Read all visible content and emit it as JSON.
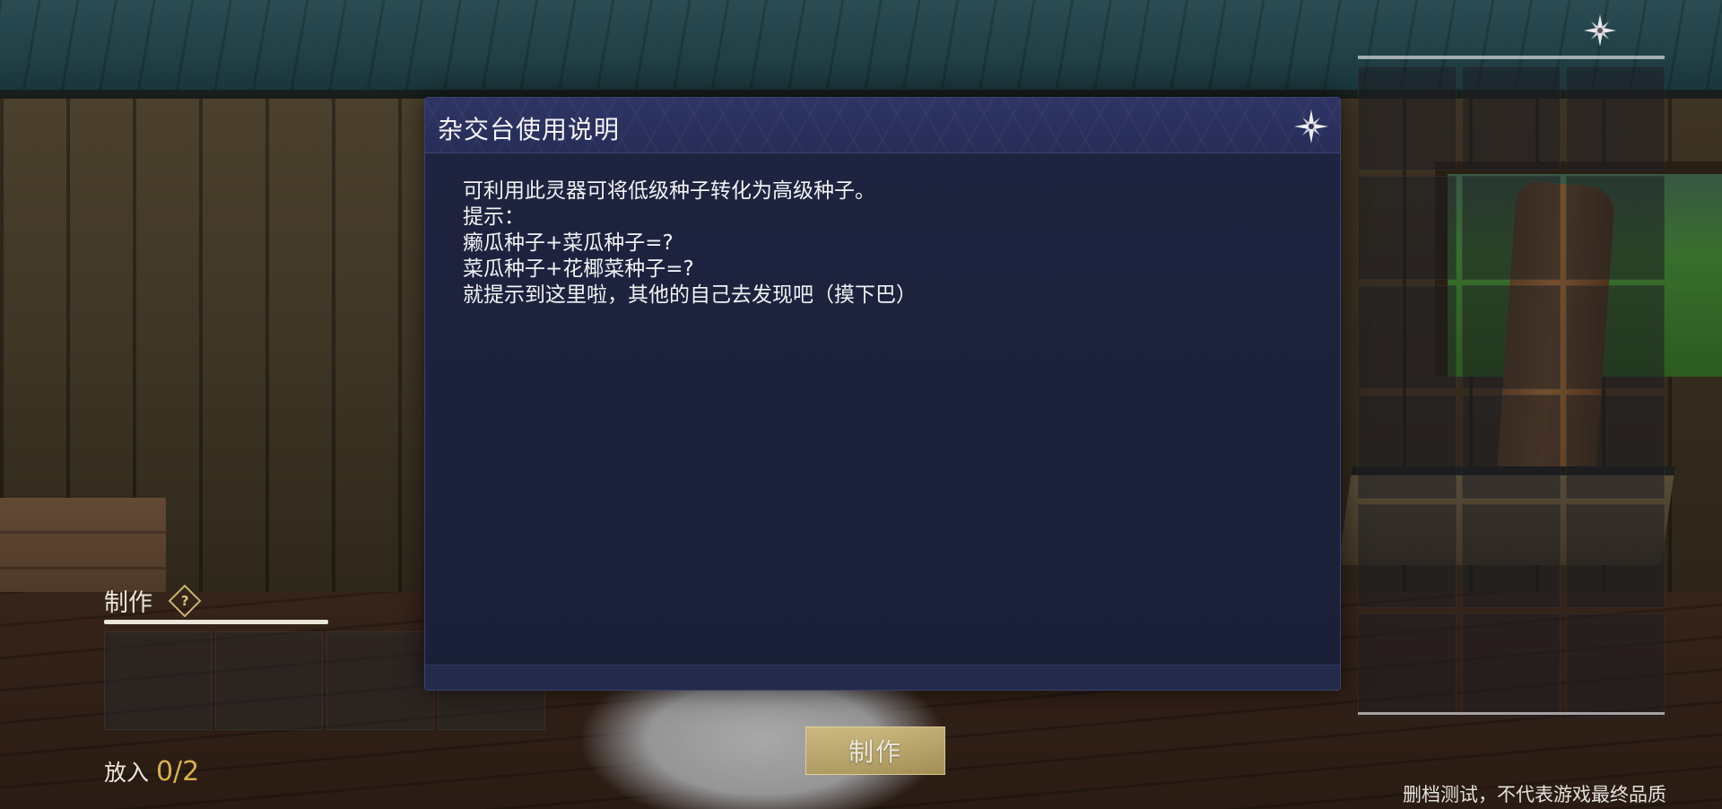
{
  "modal": {
    "title": "杂交台使用说明",
    "lines": [
      "可利用此灵器可将低级种子转化为高级种子。",
      "提示：",
      "癞瓜种子+菜瓜种子=?",
      "菜瓜种子+花椰菜种子=?",
      "就提示到这里啦，其他的自己去发现吧（摸下巴）"
    ],
    "close_icon": "shuriken-close-icon"
  },
  "craft_panel": {
    "title": "制作",
    "help_icon": "question-diamond-icon",
    "help_glyph": "?",
    "put_label": "放入",
    "put_count": "0/2",
    "button_label": "制作"
  },
  "inventory": {
    "close_icon": "shuriken-close-icon"
  },
  "watermark": "删档测试，不代表游戏最终品质",
  "colors": {
    "modal_bg": "#1e2440",
    "modal_header": "#2e3565",
    "accent_gold": "#d8b24a",
    "button_gold": "#cfbb7d"
  }
}
